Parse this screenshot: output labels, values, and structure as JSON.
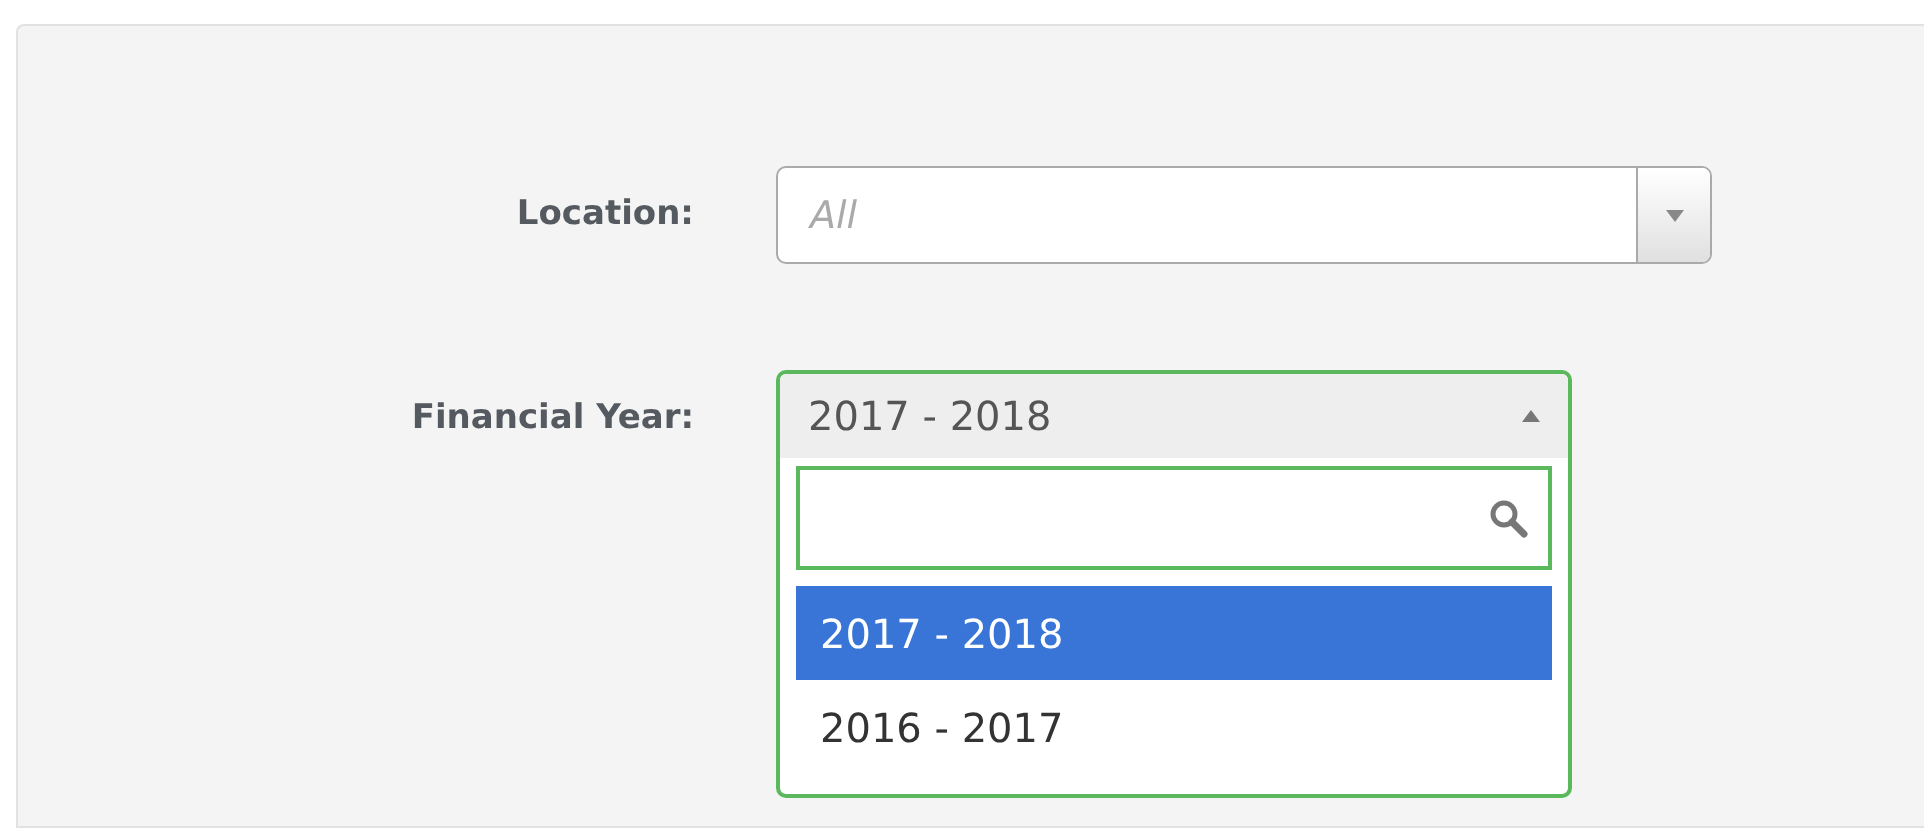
{
  "fields": [
    {
      "label": "Location:",
      "kind": "closed",
      "placeholder": "All"
    },
    {
      "label": "Financial Year:",
      "kind": "open",
      "value": "2017 - 2018",
      "options": [
        {
          "label": "2017 - 2018",
          "selected": true
        },
        {
          "label": "2016 - 2017",
          "selected": false
        }
      ]
    }
  ]
}
